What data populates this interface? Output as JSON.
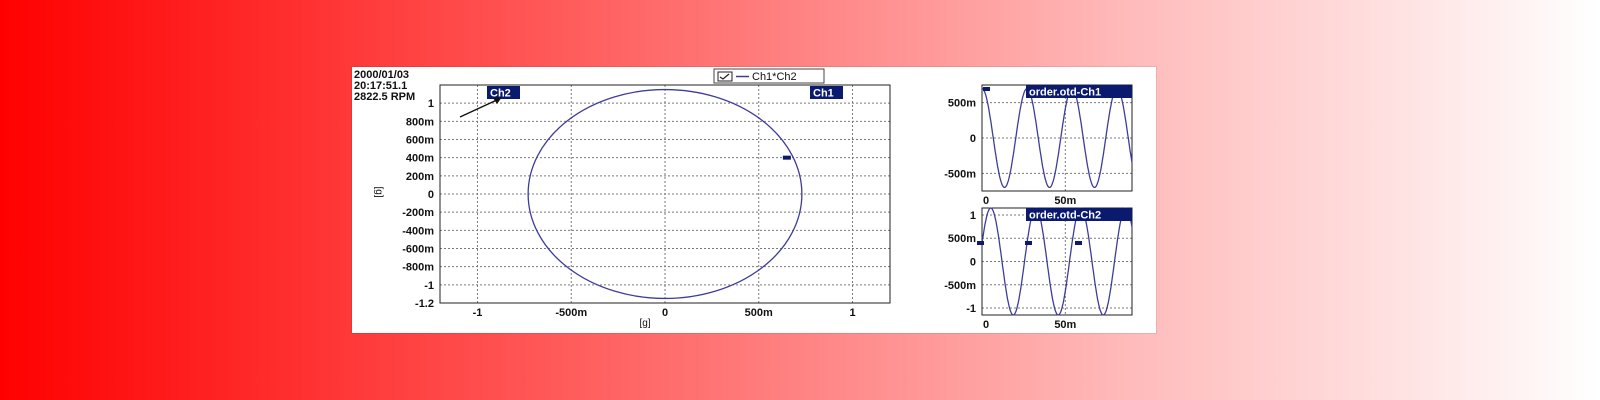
{
  "info": {
    "date": "2000/01/03",
    "time": "20:17:51.1",
    "rpm": "2822.5 RPM"
  },
  "legend": {
    "label": "Ch1*Ch2"
  },
  "colors": {
    "trace": "#3d3d9a",
    "badge_bg": "#0a1a6e",
    "grid": "#7a7a7a",
    "frame": "#222222"
  },
  "chart_data": [
    {
      "type": "scatter",
      "name": "Ch1*Ch2",
      "xlabel": "[g]",
      "ylabel": "[g]",
      "xlim": [
        -1.2,
        1.2
      ],
      "ylim": [
        -1.2,
        1.2
      ],
      "x_ticks": [
        -1,
        -0.5,
        0,
        0.5,
        1
      ],
      "x_tick_labels": [
        "-1",
        "-500m",
        "0",
        "500m",
        "1"
      ],
      "y_ticks": [
        1,
        0.8,
        0.6,
        0.4,
        0.2,
        0,
        -0.2,
        -0.4,
        -0.6,
        -0.8,
        -1,
        -1.2
      ],
      "y_tick_labels": [
        "1",
        "800m",
        "600m",
        "400m",
        "200m",
        "0",
        "-200m",
        "-400m",
        "-600m",
        "-800m",
        "-1",
        "-1.2"
      ],
      "grid": true,
      "badges": [
        "Ch2",
        "Ch1"
      ],
      "trace": {
        "center": [
          0,
          0
        ],
        "radius_x": 0.73,
        "radius_y": 1.15
      },
      "marker": {
        "x": 0.65,
        "y": 0.4
      }
    },
    {
      "type": "line",
      "name": "order.otd-Ch1",
      "x_ticks": [
        0,
        0.05
      ],
      "x_tick_labels": [
        "0",
        "50m"
      ],
      "y_ticks": [
        0.5,
        0,
        -0.5
      ],
      "y_tick_labels": [
        "500m",
        "0",
        "-500m"
      ],
      "xlim": [
        0,
        0.09
      ],
      "ylim": [
        -0.75,
        0.75
      ],
      "grid": true,
      "waveform": {
        "amplitude": 0.7,
        "period": 0.027,
        "phase_deg": 90
      }
    },
    {
      "type": "line",
      "name": "order.otd-Ch2",
      "x_ticks": [
        0,
        0.05
      ],
      "x_tick_labels": [
        "0",
        "50m"
      ],
      "y_ticks": [
        1,
        0.5,
        0,
        -0.5,
        -1
      ],
      "y_tick_labels": [
        "1",
        "500m",
        "0",
        "-500m",
        "-1"
      ],
      "xlim": [
        0,
        0.09
      ],
      "ylim": [
        -1.15,
        1.15
      ],
      "grid": true,
      "waveform": {
        "amplitude": 1.15,
        "period": 0.027,
        "phase_deg": 20
      }
    }
  ]
}
